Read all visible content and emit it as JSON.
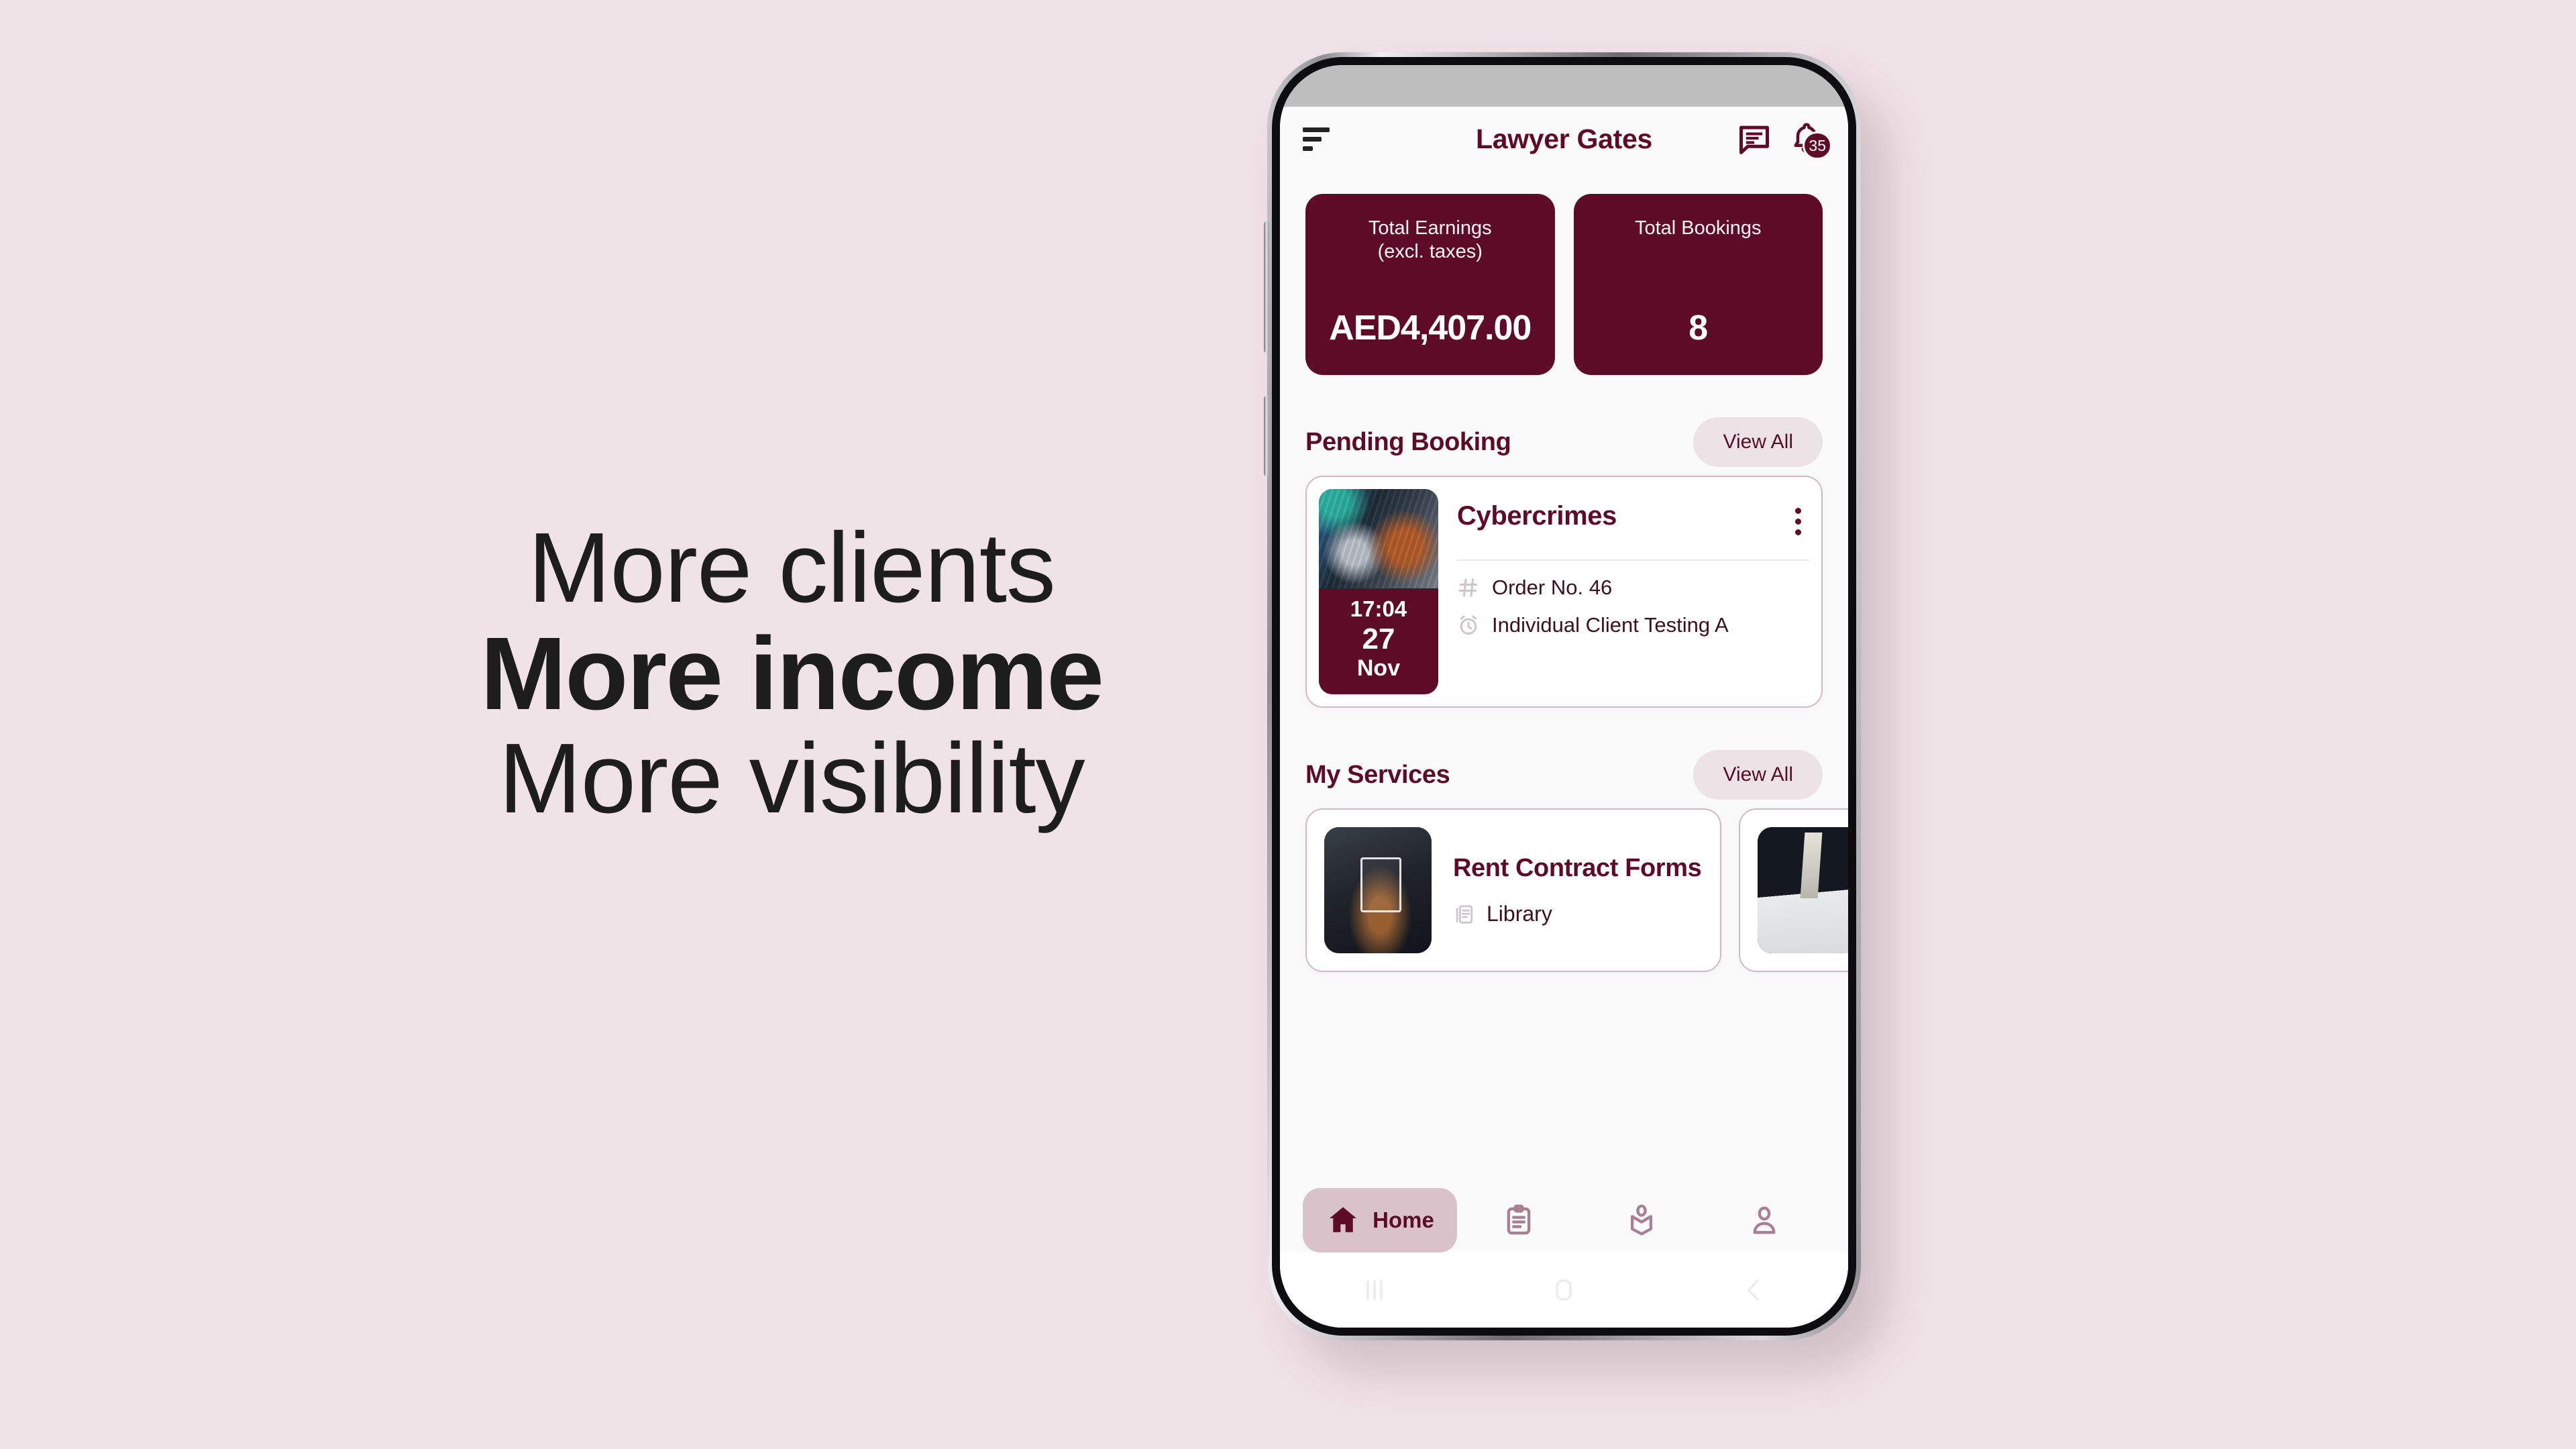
{
  "marketing": {
    "line1": "More clients",
    "line2": "More income",
    "line3": "More visibility"
  },
  "colors": {
    "background": "#f0e3e7",
    "brand": "#5e0b28",
    "accent_soft": "#ece3e6",
    "card_border": "#d6b7c2",
    "nav_active_bg": "#d9c3cb"
  },
  "header": {
    "title": "Lawyer Gates",
    "menu_icon": "hamburger-icon",
    "chat_icon": "chat-bubble-icon",
    "bell_icon": "bell-icon",
    "notification_count": "35"
  },
  "stats": [
    {
      "label": "Total Earnings\n(excl. taxes)",
      "label_line1": "Total Earnings",
      "label_line2": "(excl. taxes)",
      "value": "AED4,407.00"
    },
    {
      "label": "Total Bookings",
      "label_line1": "Total Bookings",
      "label_line2": "",
      "value": "8"
    }
  ],
  "pending_booking": {
    "section_title": "Pending Booking",
    "view_all_label": "View All",
    "card": {
      "title": "Cybercrimes",
      "time": "17:04",
      "day": "27",
      "month": "Nov",
      "thumb_icon": "cybercrime-gavel-handcuffs-photo",
      "kebab_icon": "more-vertical-icon",
      "meta": [
        {
          "icon": "hash-icon",
          "text": "Order No. 46"
        },
        {
          "icon": "alarm-clock-icon",
          "text": "Individual Client Testing A"
        }
      ]
    }
  },
  "my_services": {
    "section_title": "My Services",
    "view_all_label": "View All",
    "cards": [
      {
        "title": "Rent Contract Forms",
        "sub_icon": "library-document-icon",
        "sub_label": "Library",
        "thumb_icon": "contract-signing-photo"
      },
      {
        "title": "",
        "sub_icon": "",
        "sub_label": "",
        "thumb_icon": "lawyer-desk-photo"
      }
    ]
  },
  "bottom_nav": [
    {
      "label": "Home",
      "icon": "home-icon",
      "active": true
    },
    {
      "label": "",
      "icon": "clipboard-icon",
      "active": false
    },
    {
      "label": "",
      "icon": "book-open-icon",
      "active": false
    },
    {
      "label": "",
      "icon": "person-icon",
      "active": false
    }
  ],
  "system_nav": [
    {
      "icon": "recents-icon"
    },
    {
      "icon": "home-square-icon"
    },
    {
      "icon": "back-chevron-icon"
    }
  ]
}
